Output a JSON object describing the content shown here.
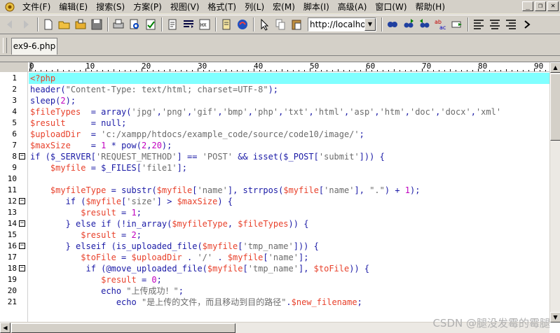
{
  "menubar": {
    "items": [
      {
        "id": "file",
        "label": "文件(F)"
      },
      {
        "id": "edit",
        "label": "编辑(E)"
      },
      {
        "id": "search",
        "label": "搜索(S)"
      },
      {
        "id": "project",
        "label": "方案(P)"
      },
      {
        "id": "view",
        "label": "视图(V)"
      },
      {
        "id": "format",
        "label": "格式(T)"
      },
      {
        "id": "column",
        "label": "列(L)"
      },
      {
        "id": "macro",
        "label": "宏(M)"
      },
      {
        "id": "script",
        "label": "脚本(I)"
      },
      {
        "id": "advanced",
        "label": "高级(A)"
      },
      {
        "id": "window",
        "label": "窗口(W)"
      },
      {
        "id": "help",
        "label": "帮助(H)"
      }
    ],
    "win_controls": [
      "_",
      "❐",
      "✕"
    ]
  },
  "toolbar": {
    "url_value": "http://localhos",
    "icons": [
      "back-icon",
      "forward-icon",
      "new-file-icon",
      "open-folder-icon",
      "open-icon",
      "save-icon",
      "print-icon",
      "print-preview-icon",
      "spellcheck-icon",
      "page-icon",
      "wrap-icon",
      "hex-icon",
      "document-icon",
      "browser-icon",
      "cursor-icon",
      "copy-icon",
      "paste-icon"
    ],
    "right_icons": [
      "find-icon",
      "find-next-icon",
      "find-prev-icon",
      "replace-icon",
      "goto-icon",
      "align-left-icon",
      "align-center-icon",
      "align-right-icon",
      "more-icon"
    ]
  },
  "tabs": {
    "active_file": "ex9-6.php"
  },
  "ruler": {
    "marks": [
      "0",
      "10",
      "20",
      "30",
      "40",
      "50",
      "60",
      "70",
      "80",
      "90"
    ]
  },
  "editor": {
    "lines": [
      {
        "n": "1",
        "fold": "",
        "active": true,
        "tokens": [
          {
            "t": "tag",
            "v": "<?php"
          }
        ]
      },
      {
        "n": "2",
        "fold": "",
        "tokens": [
          {
            "t": "fn",
            "v": "header"
          },
          {
            "t": "op",
            "v": "("
          },
          {
            "t": "str",
            "v": "\"Content-Type: text/html; charset=UTF-8\""
          },
          {
            "t": "op",
            "v": ");"
          }
        ]
      },
      {
        "n": "3",
        "fold": "",
        "tokens": [
          {
            "t": "fn",
            "v": "sleep"
          },
          {
            "t": "op",
            "v": "("
          },
          {
            "t": "num",
            "v": "2"
          },
          {
            "t": "op",
            "v": ");"
          }
        ]
      },
      {
        "n": "4",
        "fold": "",
        "tokens": [
          {
            "t": "var",
            "v": "$fileTypes"
          },
          {
            "t": "op",
            "v": "  = "
          },
          {
            "t": "fn",
            "v": "array"
          },
          {
            "t": "op",
            "v": "("
          },
          {
            "t": "str",
            "v": "'jpg'"
          },
          {
            "t": "op",
            "v": ","
          },
          {
            "t": "str",
            "v": "'png'"
          },
          {
            "t": "op",
            "v": ","
          },
          {
            "t": "str",
            "v": "'gif'"
          },
          {
            "t": "op",
            "v": ","
          },
          {
            "t": "str",
            "v": "'bmp'"
          },
          {
            "t": "op",
            "v": ","
          },
          {
            "t": "str",
            "v": "'php'"
          },
          {
            "t": "op",
            "v": ","
          },
          {
            "t": "str",
            "v": "'txt'"
          },
          {
            "t": "op",
            "v": ","
          },
          {
            "t": "str",
            "v": "'html'"
          },
          {
            "t": "op",
            "v": ","
          },
          {
            "t": "str",
            "v": "'asp'"
          },
          {
            "t": "op",
            "v": ","
          },
          {
            "t": "str",
            "v": "'htm'"
          },
          {
            "t": "op",
            "v": ","
          },
          {
            "t": "str",
            "v": "'doc'"
          },
          {
            "t": "op",
            "v": ","
          },
          {
            "t": "str",
            "v": "'docx'"
          },
          {
            "t": "op",
            "v": ","
          },
          {
            "t": "str",
            "v": "'xml'"
          }
        ]
      },
      {
        "n": "5",
        "fold": "",
        "tokens": [
          {
            "t": "var",
            "v": "$result"
          },
          {
            "t": "op",
            "v": "     = "
          },
          {
            "t": "kw",
            "v": "null"
          },
          {
            "t": "op",
            "v": ";"
          }
        ]
      },
      {
        "n": "6",
        "fold": "",
        "tokens": [
          {
            "t": "var",
            "v": "$uploadDir"
          },
          {
            "t": "op",
            "v": "  = "
          },
          {
            "t": "str",
            "v": "'c:/xampp/htdocs/example_code/source/code10/image/'"
          },
          {
            "t": "op",
            "v": ";"
          }
        ]
      },
      {
        "n": "7",
        "fold": "",
        "tokens": [
          {
            "t": "var",
            "v": "$maxSize"
          },
          {
            "t": "op",
            "v": "    = "
          },
          {
            "t": "num",
            "v": "1"
          },
          {
            "t": "op",
            "v": " * "
          },
          {
            "t": "fn",
            "v": "pow"
          },
          {
            "t": "op",
            "v": "("
          },
          {
            "t": "num",
            "v": "2"
          },
          {
            "t": "op",
            "v": ","
          },
          {
            "t": "num",
            "v": "20"
          },
          {
            "t": "op",
            "v": ");"
          }
        ]
      },
      {
        "n": "8",
        "fold": "−",
        "tokens": [
          {
            "t": "kw",
            "v": "if"
          },
          {
            "t": "op",
            "v": " ("
          },
          {
            "t": "fn",
            "v": "$_SERVER"
          },
          {
            "t": "op",
            "v": "["
          },
          {
            "t": "str",
            "v": "'REQUEST_METHOD'"
          },
          {
            "t": "op",
            "v": "] == "
          },
          {
            "t": "str",
            "v": "'POST'"
          },
          {
            "t": "op",
            "v": " && "
          },
          {
            "t": "fn",
            "v": "isset"
          },
          {
            "t": "op",
            "v": "("
          },
          {
            "t": "fn",
            "v": "$_POST"
          },
          {
            "t": "op",
            "v": "["
          },
          {
            "t": "str",
            "v": "'submit'"
          },
          {
            "t": "op",
            "v": "])) {"
          }
        ]
      },
      {
        "n": "9",
        "fold": "",
        "tokens": [
          {
            "t": "op",
            "v": "    "
          },
          {
            "t": "var",
            "v": "$myfile"
          },
          {
            "t": "op",
            "v": " = "
          },
          {
            "t": "fn",
            "v": "$_FILES"
          },
          {
            "t": "op",
            "v": "["
          },
          {
            "t": "str",
            "v": "'file1'"
          },
          {
            "t": "op",
            "v": "];"
          }
        ]
      },
      {
        "n": "10",
        "fold": "",
        "tokens": []
      },
      {
        "n": "11",
        "fold": "",
        "tokens": [
          {
            "t": "op",
            "v": "    "
          },
          {
            "t": "var",
            "v": "$myfileType"
          },
          {
            "t": "op",
            "v": " = "
          },
          {
            "t": "fn",
            "v": "substr"
          },
          {
            "t": "op",
            "v": "("
          },
          {
            "t": "var",
            "v": "$myfile"
          },
          {
            "t": "op",
            "v": "["
          },
          {
            "t": "str",
            "v": "'name'"
          },
          {
            "t": "op",
            "v": "], "
          },
          {
            "t": "fn",
            "v": "strrpos"
          },
          {
            "t": "op",
            "v": "("
          },
          {
            "t": "var",
            "v": "$myfile"
          },
          {
            "t": "op",
            "v": "["
          },
          {
            "t": "str",
            "v": "'name'"
          },
          {
            "t": "op",
            "v": "], "
          },
          {
            "t": "str",
            "v": "\".\""
          },
          {
            "t": "op",
            "v": ") + "
          },
          {
            "t": "num",
            "v": "1"
          },
          {
            "t": "op",
            "v": ");"
          }
        ]
      },
      {
        "n": "12",
        "fold": "−",
        "tokens": [
          {
            "t": "op",
            "v": "       "
          },
          {
            "t": "kw",
            "v": "if"
          },
          {
            "t": "op",
            "v": " ("
          },
          {
            "t": "var",
            "v": "$myfile"
          },
          {
            "t": "op",
            "v": "["
          },
          {
            "t": "str",
            "v": "'size'"
          },
          {
            "t": "op",
            "v": "] > "
          },
          {
            "t": "var",
            "v": "$maxSize"
          },
          {
            "t": "op",
            "v": ") {"
          }
        ]
      },
      {
        "n": "13",
        "fold": "",
        "tokens": [
          {
            "t": "op",
            "v": "          "
          },
          {
            "t": "var",
            "v": "$result"
          },
          {
            "t": "op",
            "v": " = "
          },
          {
            "t": "num",
            "v": "1"
          },
          {
            "t": "op",
            "v": ";"
          }
        ]
      },
      {
        "n": "14",
        "fold": "−",
        "tokens": [
          {
            "t": "op",
            "v": "       } "
          },
          {
            "t": "kw",
            "v": "else if"
          },
          {
            "t": "op",
            "v": " (!"
          },
          {
            "t": "fn",
            "v": "in_array"
          },
          {
            "t": "op",
            "v": "("
          },
          {
            "t": "var",
            "v": "$myfileType"
          },
          {
            "t": "op",
            "v": ", "
          },
          {
            "t": "var",
            "v": "$fileTypes"
          },
          {
            "t": "op",
            "v": ")) {"
          }
        ]
      },
      {
        "n": "15",
        "fold": "",
        "tokens": [
          {
            "t": "op",
            "v": "          "
          },
          {
            "t": "var",
            "v": "$result"
          },
          {
            "t": "op",
            "v": " = "
          },
          {
            "t": "num",
            "v": "2"
          },
          {
            "t": "op",
            "v": ";"
          }
        ]
      },
      {
        "n": "16",
        "fold": "−",
        "tokens": [
          {
            "t": "op",
            "v": "       } "
          },
          {
            "t": "kw",
            "v": "elseif"
          },
          {
            "t": "op",
            "v": " ("
          },
          {
            "t": "fn",
            "v": "is_uploaded_file"
          },
          {
            "t": "op",
            "v": "("
          },
          {
            "t": "var",
            "v": "$myfile"
          },
          {
            "t": "op",
            "v": "["
          },
          {
            "t": "str",
            "v": "'tmp_name'"
          },
          {
            "t": "op",
            "v": "])) {"
          }
        ]
      },
      {
        "n": "17",
        "fold": "",
        "tokens": [
          {
            "t": "op",
            "v": "          "
          },
          {
            "t": "var",
            "v": "$toFile"
          },
          {
            "t": "op",
            "v": " = "
          },
          {
            "t": "var",
            "v": "$uploadDir"
          },
          {
            "t": "op",
            "v": " . "
          },
          {
            "t": "str",
            "v": "'/'"
          },
          {
            "t": "op",
            "v": " . "
          },
          {
            "t": "var",
            "v": "$myfile"
          },
          {
            "t": "op",
            "v": "["
          },
          {
            "t": "str",
            "v": "'name'"
          },
          {
            "t": "op",
            "v": "];"
          }
        ]
      },
      {
        "n": "18",
        "fold": "−",
        "tokens": [
          {
            "t": "op",
            "v": "           "
          },
          {
            "t": "kw",
            "v": "if"
          },
          {
            "t": "op",
            "v": " (@"
          },
          {
            "t": "fn",
            "v": "move_uploaded_file"
          },
          {
            "t": "op",
            "v": "("
          },
          {
            "t": "var",
            "v": "$myfile"
          },
          {
            "t": "op",
            "v": "["
          },
          {
            "t": "str",
            "v": "'tmp_name'"
          },
          {
            "t": "op",
            "v": "], "
          },
          {
            "t": "var",
            "v": "$toFile"
          },
          {
            "t": "op",
            "v": ")) {"
          }
        ]
      },
      {
        "n": "19",
        "fold": "",
        "tokens": [
          {
            "t": "op",
            "v": "              "
          },
          {
            "t": "var",
            "v": "$result"
          },
          {
            "t": "op",
            "v": " = "
          },
          {
            "t": "num",
            "v": "0"
          },
          {
            "t": "op",
            "v": ";"
          }
        ]
      },
      {
        "n": "20",
        "fold": "",
        "tokens": [
          {
            "t": "op",
            "v": "              "
          },
          {
            "t": "kw",
            "v": "echo"
          },
          {
            "t": "op",
            "v": " "
          },
          {
            "t": "str",
            "v": "\"上传成功！\""
          },
          {
            "t": "op",
            "v": ";"
          }
        ]
      },
      {
        "n": "21",
        "fold": "",
        "tokens": [
          {
            "t": "op",
            "v": "                 "
          },
          {
            "t": "kw",
            "v": "echo"
          },
          {
            "t": "op",
            "v": " "
          },
          {
            "t": "str",
            "v": "\"是上传的文件，而且移动到目的路径\""
          },
          {
            "t": "op",
            "v": "."
          },
          {
            "t": "var",
            "v": "$new_filename"
          },
          {
            "t": "op",
            "v": ";"
          }
        ]
      }
    ]
  },
  "watermark": "CSDN @腿没发霉的霉腿"
}
